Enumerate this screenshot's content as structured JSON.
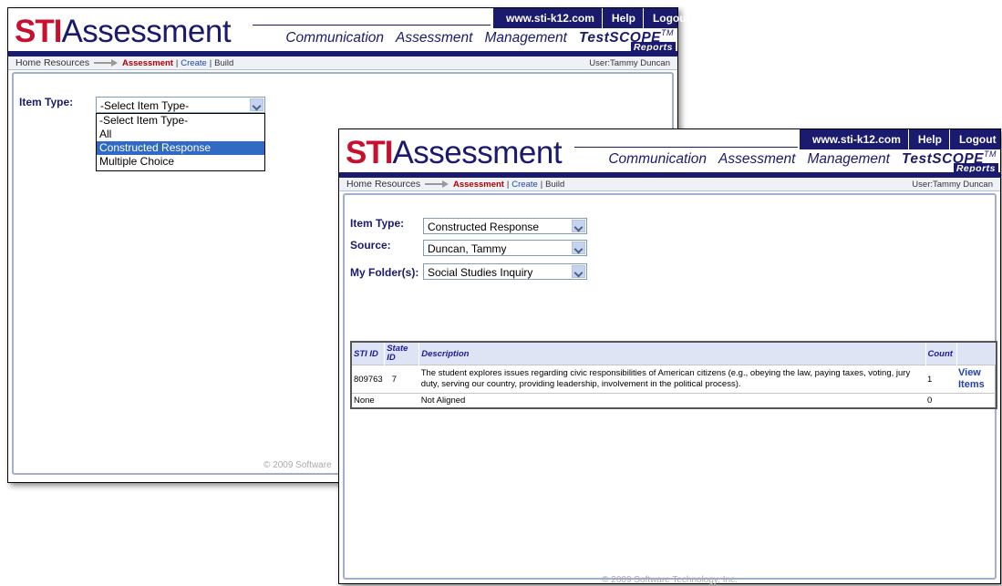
{
  "header": {
    "logo_bold": "STI",
    "logo_rest": "Assessment",
    "top_links": [
      "www.sti-k12.com",
      "Help",
      "Logout"
    ],
    "nav": [
      "Communication",
      "Assessment",
      "Management"
    ],
    "testscope": "TestSCOPE",
    "testscope_tm": "TM",
    "testscope_sub": "Reports"
  },
  "breadcrumb": {
    "home": "Home",
    "resources": "Resources",
    "current": "Assessment",
    "sep": "|",
    "create": "Create",
    "build": "Build",
    "user": "User:Tammy Duncan"
  },
  "window1": {
    "item_type_label": "Item Type:",
    "item_type_value": "-Select Item Type-",
    "options": [
      "-Select Item Type-",
      "All",
      "Constructed Response",
      "Multiple Choice"
    ],
    "highlighted_option": "Constructed Response",
    "footer_partial": "© 2009 Software"
  },
  "window2": {
    "item_type_label": "Item Type:",
    "item_type_value": "Constructed Response",
    "source_label": "Source:",
    "source_value": "Duncan, Tammy",
    "folder_label": "My Folder(s):",
    "folder_value": "Social Studies Inquiry",
    "table": {
      "headers": [
        "STI ID",
        "State ID",
        "Description",
        "Count",
        ""
      ],
      "rows": [
        {
          "sti_id": "809763",
          "state_id": "7",
          "description": "The student explores issues regarding civic responsibilities of American citizens (e.g., obeying the law, paying taxes, voting, jury duty, serving our country, providing leadership, involvement in the political process).",
          "count": "1",
          "action": "View Items"
        },
        {
          "sti_id": "None",
          "state_id": "",
          "description": "Not Aligned",
          "count": "0",
          "action": ""
        }
      ]
    },
    "footer": "© 2009 Software Technology, Inc."
  },
  "colors": {
    "brand_red": "#c8102e",
    "brand_navy": "#1a1a6e",
    "highlight": "#316ac5"
  }
}
